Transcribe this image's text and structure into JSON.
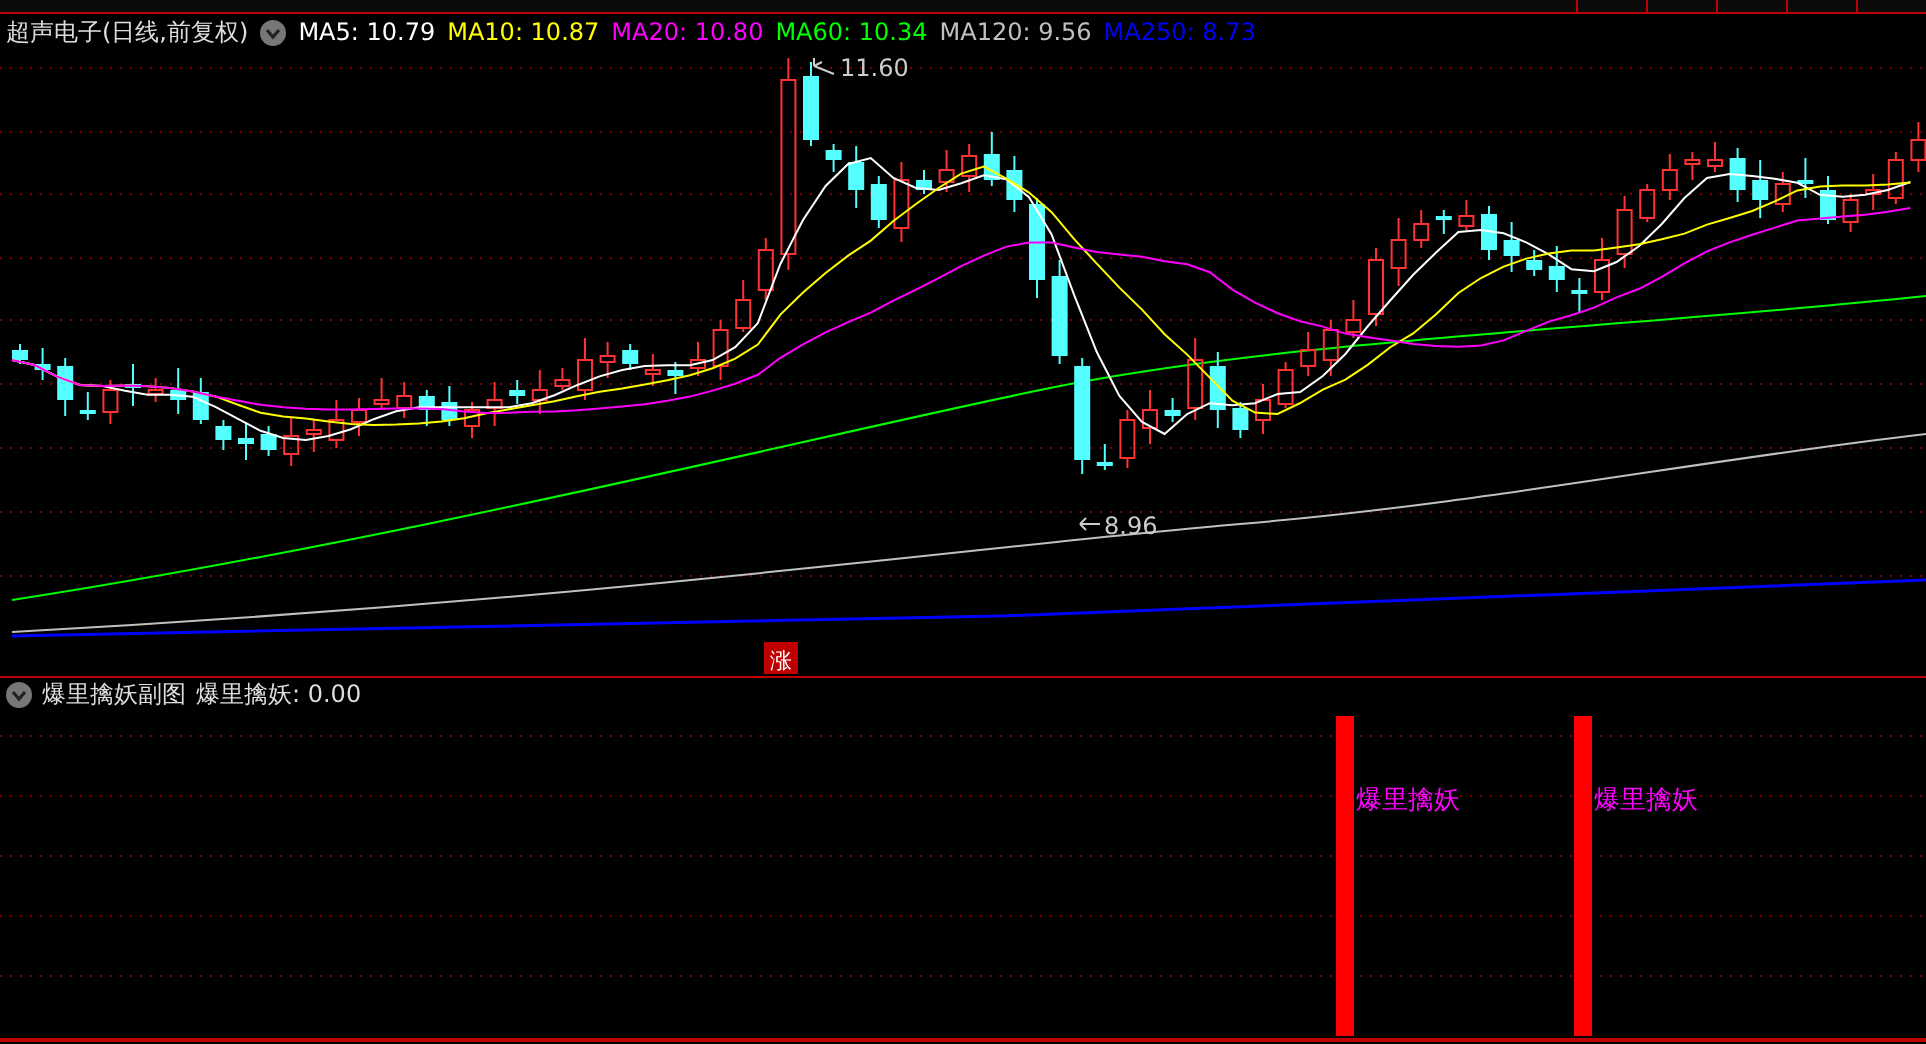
{
  "chart_title": "超声电子(日线,前复权)",
  "ma_legend": [
    {
      "label": "MA5: 10.79",
      "color": "#ffffff"
    },
    {
      "label": "MA10: 10.87",
      "color": "#ffff00"
    },
    {
      "label": "MA20: 10.80",
      "color": "#ff00ff"
    },
    {
      "label": "MA60: 10.34",
      "color": "#00ff00"
    },
    {
      "label": "MA120: 9.56",
      "color": "#c0c0c0"
    },
    {
      "label": "MA250: 8.73",
      "color": "#0000ff"
    }
  ],
  "price_markers": {
    "high": "11.60",
    "low": "8.96"
  },
  "rise_marker": "涨",
  "sub_panel": {
    "title": "爆里擒妖副图",
    "indicator": "爆里擒妖: 0.00",
    "signals": [
      {
        "label": "爆里擒妖"
      },
      {
        "label": "爆里擒妖"
      }
    ]
  }
}
